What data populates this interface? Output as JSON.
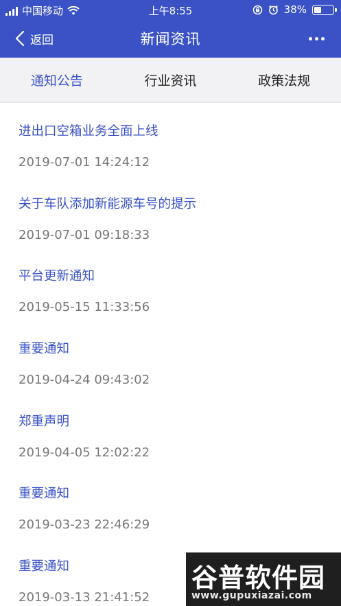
{
  "status_bar": {
    "carrier": "中国移动",
    "time": "上午8:55",
    "battery": "38%",
    "battery_level": 0.38,
    "wifi_icon": "wifi-icon",
    "lock_icon": "orientation-lock-icon",
    "alarm_icon": "alarm-icon"
  },
  "nav": {
    "back_label": "返回",
    "title": "新闻资讯",
    "back_icon": "chevron-left-icon",
    "more_icon": "more-dots-icon"
  },
  "tabs": [
    {
      "label": "通知公告",
      "active": true
    },
    {
      "label": "行业资讯",
      "active": false
    },
    {
      "label": "政策法规",
      "active": false
    }
  ],
  "news": [
    {
      "title": "进出口空箱业务全面上线",
      "date": "2019-07-01 14:24:12"
    },
    {
      "title": "关于车队添加新能源车号的提示",
      "date": "2019-07-01 09:18:33"
    },
    {
      "title": "平台更新通知",
      "date": "2019-05-15 11:33:56"
    },
    {
      "title": "重要通知",
      "date": "2019-04-24 09:43:02"
    },
    {
      "title": "郑重声明",
      "date": "2019-04-05 12:02:22"
    },
    {
      "title": "重要通知",
      "date": "2019-03-23 22:46:29"
    },
    {
      "title": "重要通知",
      "date": "2019-03-13 21:41:52"
    }
  ],
  "watermark": {
    "logo_text": "谷普软件园",
    "url": "www.gupuxiazai.com"
  },
  "colors": {
    "primary": "#3a52c6",
    "date_text": "#777777",
    "tab_bg": "#f2f2f4"
  }
}
